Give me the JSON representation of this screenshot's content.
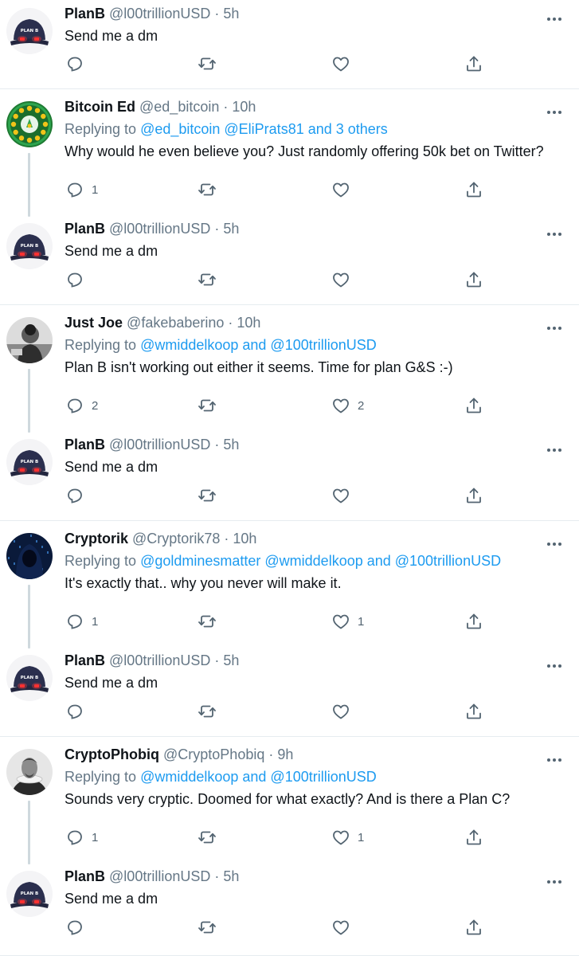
{
  "tweets": [
    {
      "name": "PlanB",
      "handle": "@l00trillionUSD",
      "time": "5h",
      "text": "Send me a dm",
      "avatar": "planb",
      "reply_count": "",
      "like_count": ""
    },
    {
      "name": "Bitcoin Ed",
      "handle": "@ed_bitcoin",
      "time": "10h",
      "replying_prefix": "Replying to ",
      "replying_links": "@ed_bitcoin @EliPrats81 and 3 others",
      "text": "Why would he even believe you? Just randomly offering 50k bet on Twitter?",
      "avatar": "bitcoin-ed",
      "reply_count": "1",
      "like_count": ""
    },
    {
      "name": "PlanB",
      "handle": "@l00trillionUSD",
      "time": "5h",
      "text": "Send me a dm",
      "avatar": "planb",
      "reply_count": "",
      "like_count": ""
    },
    {
      "name": "Just Joe",
      "handle": "@fakebaberino",
      "time": "10h",
      "replying_prefix": "Replying to ",
      "replying_links": "@wmiddelkoop and @100trillionUSD",
      "text": "Plan B isn't working out either it seems. Time for plan G&S :-)",
      "avatar": "just-joe",
      "reply_count": "2",
      "like_count": "2"
    },
    {
      "name": "PlanB",
      "handle": "@l00trillionUSD",
      "time": "5h",
      "text": "Send me a dm",
      "avatar": "planb",
      "reply_count": "",
      "like_count": ""
    },
    {
      "name": "Cryptorik",
      "handle": "@Cryptorik78",
      "time": "10h",
      "replying_prefix": "Replying to ",
      "replying_links": "@goldminesmatter @wmiddelkoop and @100trillionUSD",
      "text": "It's exactly that.. why you never will make it.",
      "avatar": "cryptorik",
      "reply_count": "1",
      "like_count": "1"
    },
    {
      "name": "PlanB",
      "handle": "@l00trillionUSD",
      "time": "5h",
      "text": "Send me a dm",
      "avatar": "planb",
      "reply_count": "",
      "like_count": ""
    },
    {
      "name": "CryptoPhobiq",
      "handle": "@CryptoPhobiq",
      "time": "9h",
      "replying_prefix": "Replying to ",
      "replying_links": "@wmiddelkoop and @100trillionUSD",
      "text": "Sounds very cryptic. Doomed for what exactly? And is there a Plan C?",
      "avatar": "cryptophobiq",
      "reply_count": "1",
      "like_count": "1"
    },
    {
      "name": "PlanB",
      "handle": "@l00trillionUSD",
      "time": "5h",
      "text": "Send me a dm",
      "avatar": "planb",
      "reply_count": "",
      "like_count": ""
    }
  ],
  "separator": " · ",
  "avatar_label": "PLAN B",
  "colors": {
    "link": "#1d9bf0",
    "muted": "#657786",
    "border": "#e6ecf0",
    "thread": "#cfd9de"
  }
}
